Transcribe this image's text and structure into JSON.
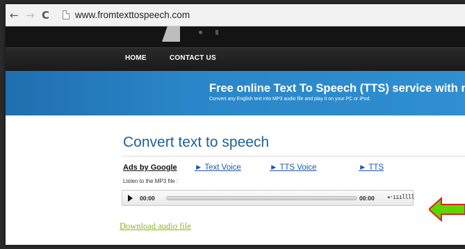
{
  "browser": {
    "url": "www.fromtexttospeech.com",
    "back_glyph": "←",
    "forward_glyph": "→",
    "reload_glyph": "C"
  },
  "nav": {
    "items": [
      "HOME",
      "CONTACT US"
    ]
  },
  "banner": {
    "title": "Free online Text To Speech (TTS) service with na",
    "subtitle": "Convert any English text into MP3 audio file and play it on your PC or iPod."
  },
  "main": {
    "title": "Convert text to speech",
    "ads_label": "Ads by Google",
    "ad_links": [
      "► Text Voice",
      "► TTS Voice",
      "► TTS"
    ],
    "listen_label": "Listen to the MP3 file :",
    "player": {
      "current_time": "00:00",
      "total_time": "00:00",
      "progress": 0,
      "volume_glyph": "◂·ıııllll"
    },
    "download_label": "Download audio file"
  },
  "colors": {
    "title_blue": "#1f5f9a",
    "link_blue": "#1a55b8",
    "download_green": "#8ab128",
    "arrow_green": "#5fd400",
    "arrow_red": "#e02020"
  },
  "icons": {
    "back": "back-arrow-icon",
    "forward": "forward-arrow-icon",
    "reload": "reload-icon",
    "page": "page-icon",
    "play": "play-icon",
    "volume": "volume-icon",
    "annotation": "annotation-arrow-icon"
  }
}
